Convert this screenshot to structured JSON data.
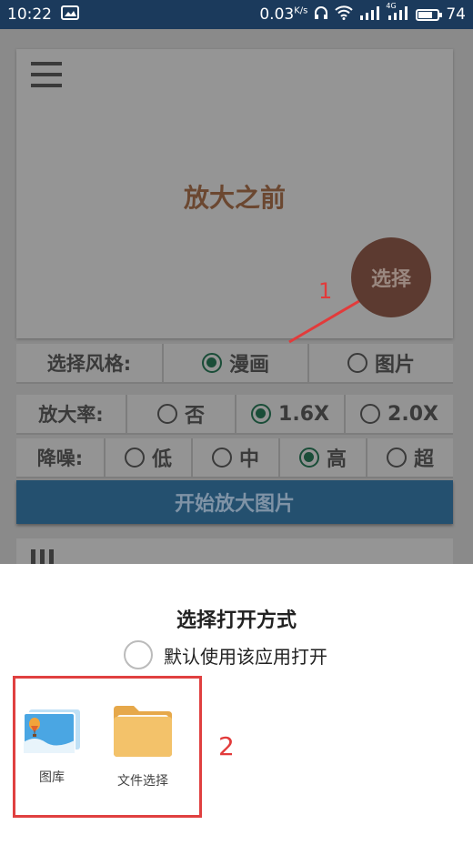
{
  "status_bar": {
    "time": "10:22",
    "net_speed": "0.03",
    "net_speed_unit": "K/s",
    "signal_label": "4G",
    "battery_level": "74",
    "battery_fraction": 0.74
  },
  "app": {
    "before_label": "放大之前",
    "select_button": "选择",
    "style_row": {
      "label": "选择风格:",
      "options": [
        {
          "label": "漫画",
          "checked": true
        },
        {
          "label": "图片",
          "checked": false
        }
      ]
    },
    "scale_row": {
      "label": "放大率:",
      "options": [
        {
          "label": "否",
          "checked": false
        },
        {
          "label": "1.6X",
          "checked": true
        },
        {
          "label": "2.0X",
          "checked": false
        }
      ]
    },
    "noise_row": {
      "label": "降噪:",
      "options": [
        {
          "label": "低",
          "checked": false
        },
        {
          "label": "中",
          "checked": false
        },
        {
          "label": "高",
          "checked": true
        },
        {
          "label": "超",
          "checked": false
        }
      ]
    },
    "start_button": "开始放大图片"
  },
  "annotations": {
    "step1": "1",
    "step2": "2"
  },
  "sheet": {
    "title": "选择打开方式",
    "default_option": "默认使用该应用打开",
    "apps": [
      {
        "label": "图库",
        "icon": "gallery-icon"
      },
      {
        "label": "文件选择",
        "icon": "folder-icon"
      }
    ]
  },
  "colors": {
    "status_bar": "#1b3a5c",
    "dim_overlay": "#8a8a8a",
    "accent_red": "#e23b3b",
    "fab": "#5c3a30",
    "start_button": "#24506f",
    "radio_checked": "#1a4d38"
  }
}
